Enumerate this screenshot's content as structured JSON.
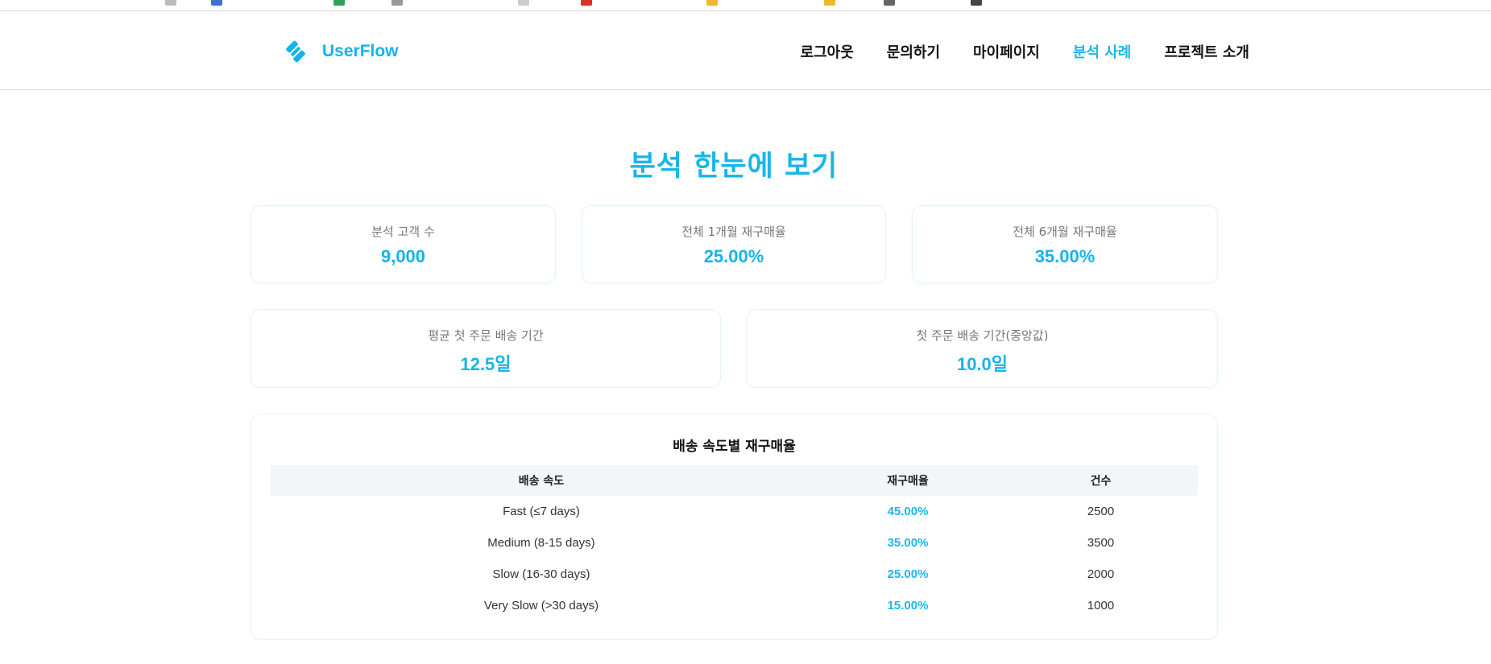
{
  "header": {
    "brand": "UserFlow",
    "nav": [
      {
        "label": "로그아웃",
        "active": false
      },
      {
        "label": "문의하기",
        "active": false
      },
      {
        "label": "마이페이지",
        "active": false
      },
      {
        "label": "분석 사례",
        "active": true
      },
      {
        "label": "프로젝트 소개",
        "active": false
      }
    ]
  },
  "page": {
    "title": "분석 한눈에 보기"
  },
  "stats_row1": [
    {
      "label": "분석 고객 수",
      "value": "9,000"
    },
    {
      "label": "전체 1개월 재구매율",
      "value": "25.00%"
    },
    {
      "label": "전체 6개월 재구매율",
      "value": "35.00%"
    }
  ],
  "stats_row2": [
    {
      "label": "평균 첫 주문 배송 기간",
      "value": "12.5일"
    },
    {
      "label": "첫 주문 배송 기간(중앙값)",
      "value": "10.0일"
    }
  ],
  "table": {
    "title": "배송 속도별 재구매율",
    "headers": [
      "배송 속도",
      "재구매율",
      "건수"
    ],
    "rows": [
      [
        "Fast (≤7 days)",
        "45.00%",
        "2500"
      ],
      [
        "Medium (8-15 days)",
        "35.00%",
        "3500"
      ],
      [
        "Slow (16-30 days)",
        "25.00%",
        "2000"
      ],
      [
        "Very Slow (>30 days)",
        "15.00%",
        "1000"
      ]
    ]
  },
  "colors": {
    "accent": "#1cb6ea",
    "text": "#111111",
    "muted": "#777777",
    "table_header_bg": "#f3f5f9"
  },
  "icons": {
    "brand": "link-chain-icon"
  }
}
